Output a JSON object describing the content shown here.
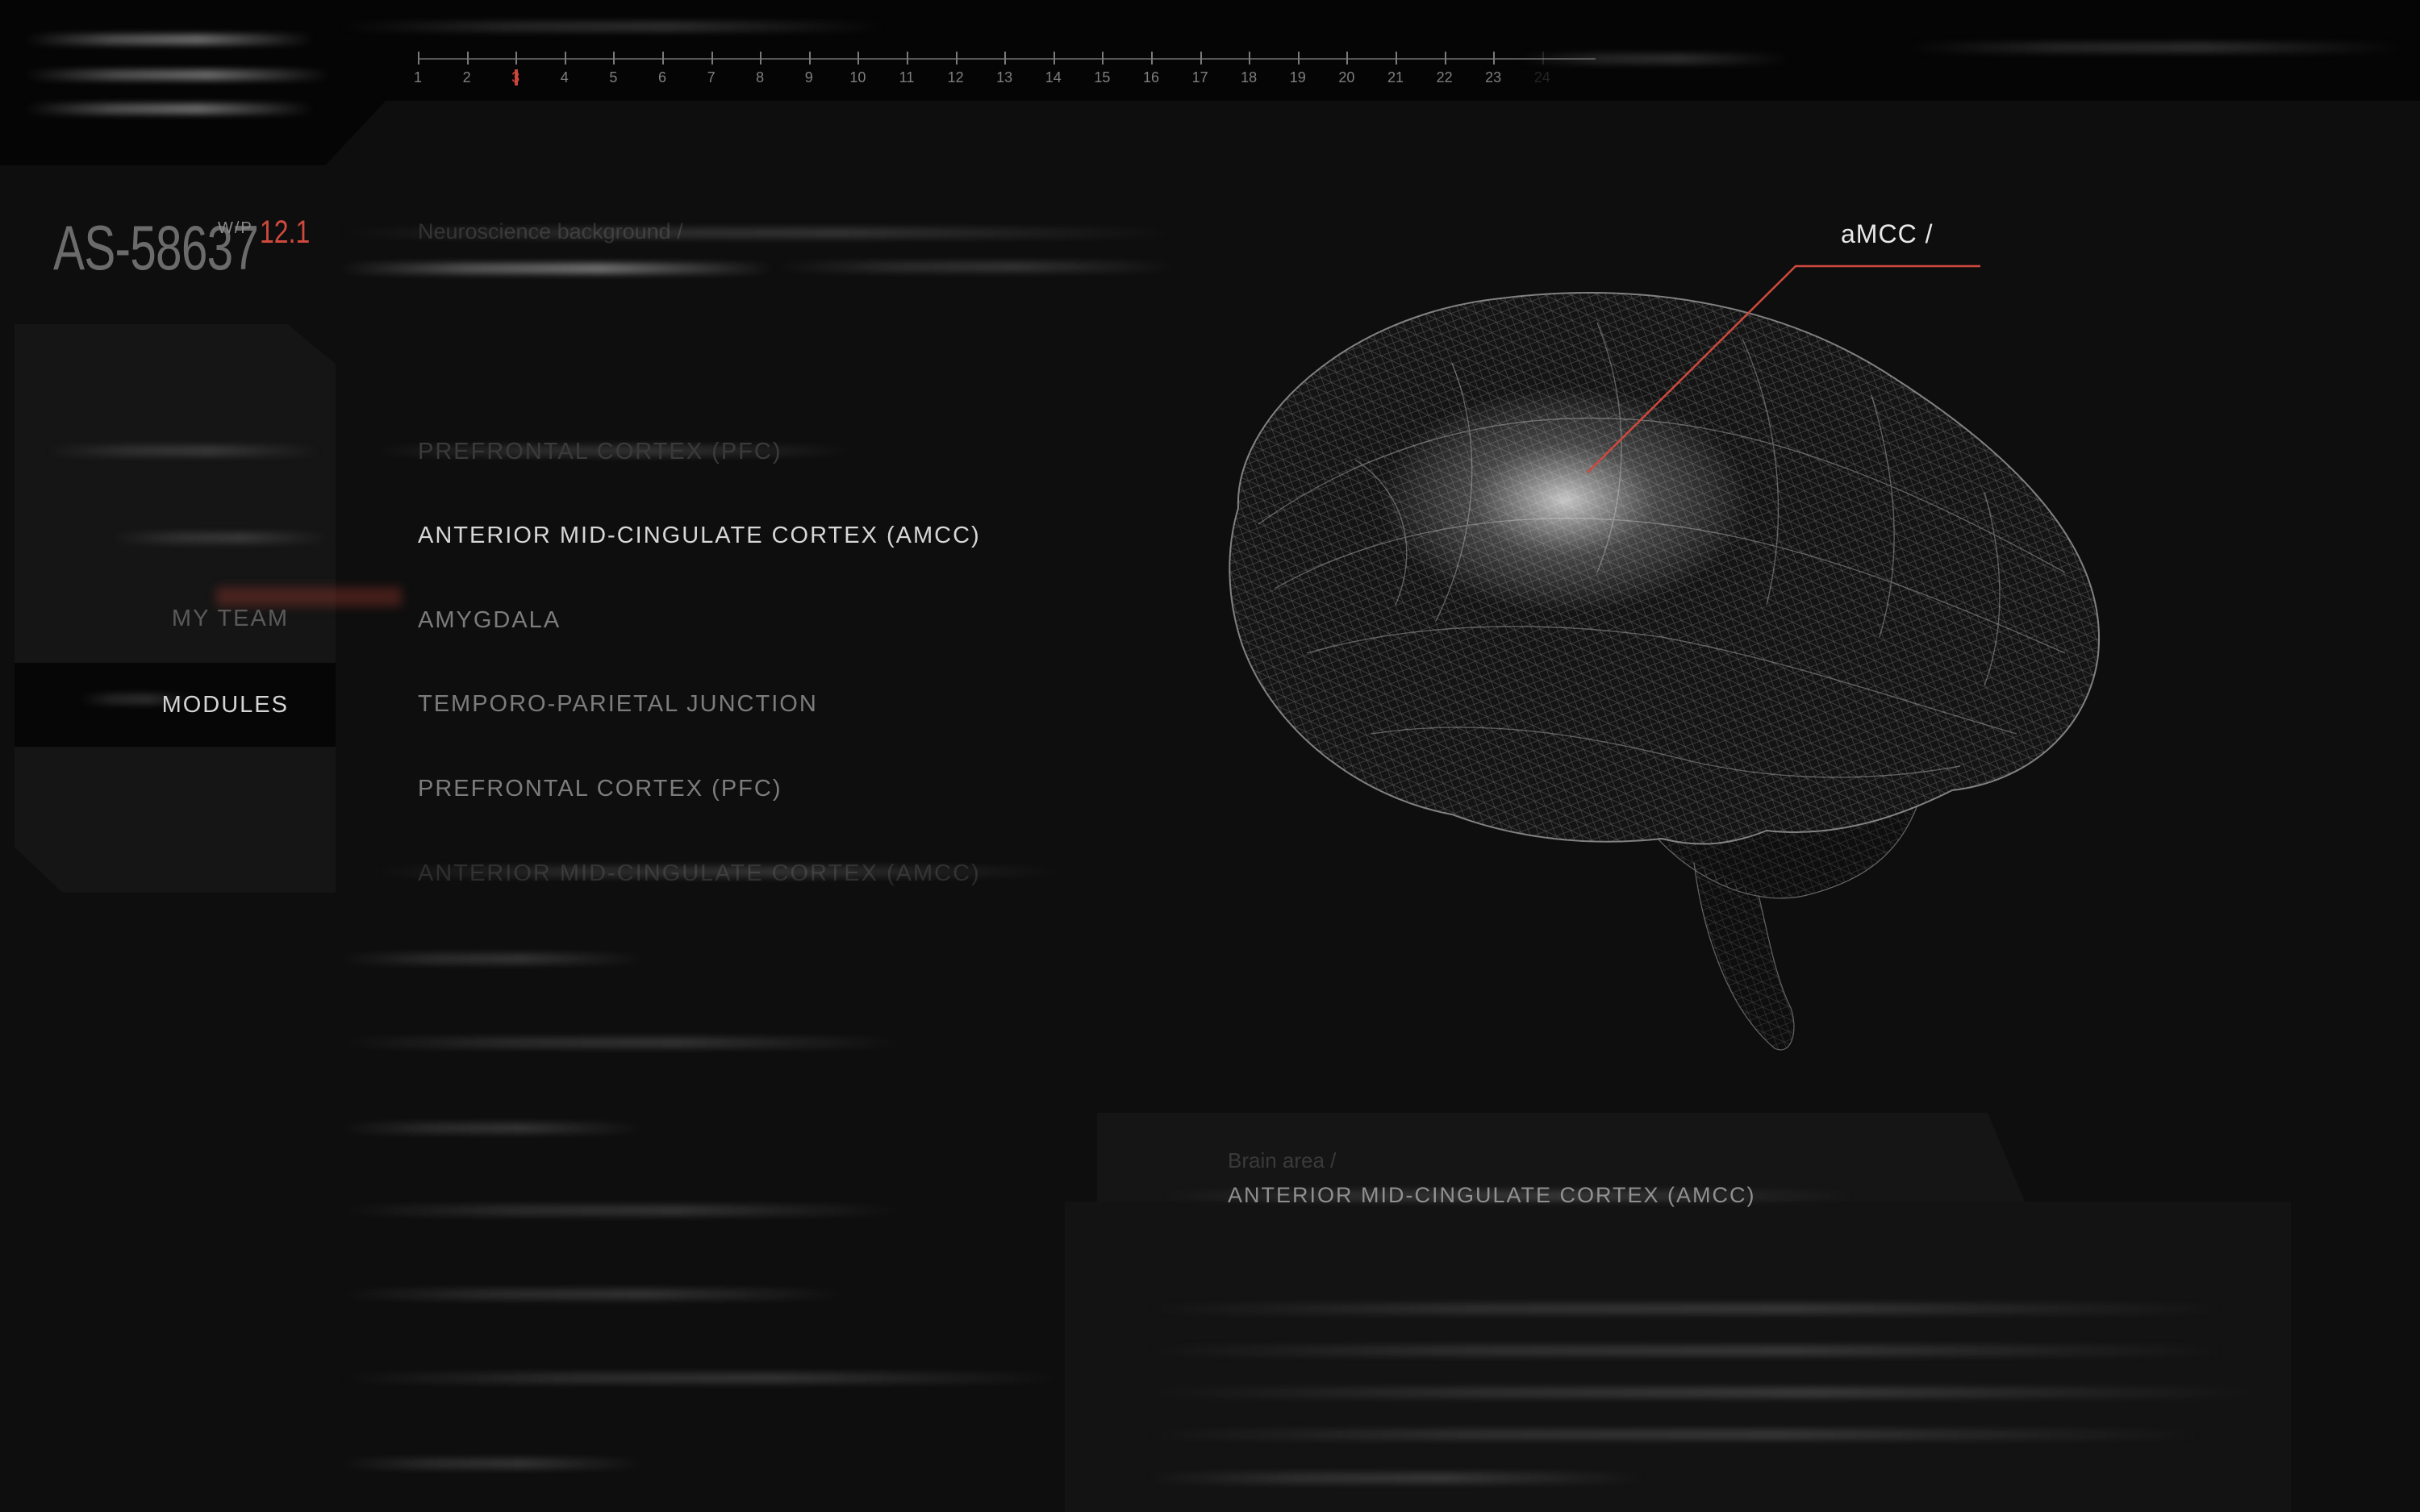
{
  "header": {
    "ruler": {
      "ticks": [
        "1",
        "2",
        "3",
        "4",
        "5",
        "6",
        "7",
        "8",
        "9",
        "10",
        "11",
        "12",
        "13",
        "14",
        "15",
        "16",
        "17",
        "18",
        "19",
        "20",
        "21",
        "22",
        "23",
        "24"
      ],
      "active_index": 2
    }
  },
  "profile": {
    "id": "AS-58637",
    "wp_label": "W/P",
    "wp_value": "12.1"
  },
  "sidebar": {
    "items": [
      {
        "label": "MY TEAM",
        "active": false
      },
      {
        "label": "MODULES",
        "active": true
      }
    ]
  },
  "content": {
    "caption": "Neuroscience background /",
    "modules": [
      {
        "label": "PREFRONTAL CORTEX (PFC)",
        "state": "dim"
      },
      {
        "label": "ANTERIOR MID-CINGULATE CORTEX (AMCC)",
        "state": "current"
      },
      {
        "label": "AMYGDALA",
        "state": "normal"
      },
      {
        "label": "TEMPORO-PARIETAL JUNCTION",
        "state": "normal"
      },
      {
        "label": "PREFRONTAL CORTEX (PFC)",
        "state": "normal"
      },
      {
        "label": "ANTERIOR MID-CINGULATE CORTEX (AMCC)",
        "state": "faded"
      }
    ]
  },
  "visual": {
    "callout_label": "aMCC /"
  },
  "detail": {
    "caption": "Brain area /",
    "title": "ANTERIOR MID-CINGULATE CORTEX (AMCC)"
  },
  "colors": {
    "accent": "#d0493d",
    "background": "#0e0e0e"
  }
}
